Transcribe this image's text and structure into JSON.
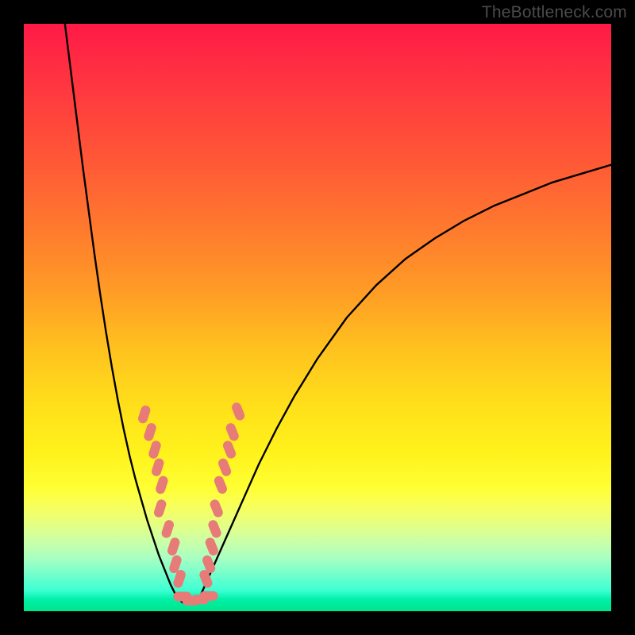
{
  "watermark": "TheBottleneck.com",
  "chart_data": {
    "type": "line",
    "title": "",
    "xlabel": "",
    "ylabel": "",
    "xlim": [
      0,
      100
    ],
    "ylim": [
      0,
      100
    ],
    "grid": false,
    "legend": false,
    "series": [
      {
        "name": "curve-left",
        "x": [
          7,
          8,
          9,
          10,
          11,
          12,
          13,
          14,
          15,
          16,
          17,
          18,
          19,
          20,
          21,
          22,
          23,
          24,
          25,
          26
        ],
        "y": [
          100,
          92,
          84,
          76,
          68.5,
          61,
          54,
          47.5,
          41.5,
          36,
          31,
          26.5,
          22.5,
          19,
          15.5,
          12.5,
          9.5,
          7,
          4.5,
          2.5
        ]
      },
      {
        "name": "curve-bottom",
        "x": [
          26,
          27,
          28,
          29,
          30
        ],
        "y": [
          2.5,
          1.5,
          1.2,
          1.5,
          2.5
        ]
      },
      {
        "name": "curve-right",
        "x": [
          30,
          32,
          34,
          36,
          38,
          40,
          43,
          46,
          50,
          55,
          60,
          65,
          70,
          75,
          80,
          85,
          90,
          95,
          100
        ],
        "y": [
          2.5,
          7,
          11.5,
          16,
          20.5,
          25,
          31,
          36.5,
          43,
          50,
          55.5,
          60,
          63.5,
          66.5,
          69,
          71,
          73,
          74.5,
          76
        ]
      }
    ],
    "markers": [
      {
        "series": "left-dots",
        "shape": "rounded",
        "color": "#e77b78",
        "points": [
          {
            "x": 20.5,
            "y": 33.5
          },
          {
            "x": 21.5,
            "y": 30.5
          },
          {
            "x": 22.3,
            "y": 27.5
          },
          {
            "x": 22.8,
            "y": 24.5
          },
          {
            "x": 23.5,
            "y": 21.5
          },
          {
            "x": 23.2,
            "y": 17.5
          },
          {
            "x": 24.5,
            "y": 14.0
          },
          {
            "x": 25.5,
            "y": 11.0
          },
          {
            "x": 25.8,
            "y": 8.0
          },
          {
            "x": 26.5,
            "y": 5.5
          }
        ]
      },
      {
        "series": "bottom-dots",
        "shape": "rounded",
        "color": "#e77b78",
        "points": [
          {
            "x": 27.0,
            "y": 2.5
          },
          {
            "x": 28.5,
            "y": 1.8
          },
          {
            "x": 30.0,
            "y": 2.0
          },
          {
            "x": 31.5,
            "y": 2.6
          }
        ]
      },
      {
        "series": "right-dots",
        "shape": "rounded",
        "color": "#e77b78",
        "points": [
          {
            "x": 31.0,
            "y": 5.5
          },
          {
            "x": 31.5,
            "y": 8.0
          },
          {
            "x": 32.0,
            "y": 11.0
          },
          {
            "x": 32.5,
            "y": 14.0
          },
          {
            "x": 32.8,
            "y": 17.5
          },
          {
            "x": 33.5,
            "y": 21.5
          },
          {
            "x": 34.2,
            "y": 24.5
          },
          {
            "x": 35.0,
            "y": 27.5
          },
          {
            "x": 35.5,
            "y": 30.5
          },
          {
            "x": 36.5,
            "y": 34.0
          }
        ]
      }
    ]
  }
}
